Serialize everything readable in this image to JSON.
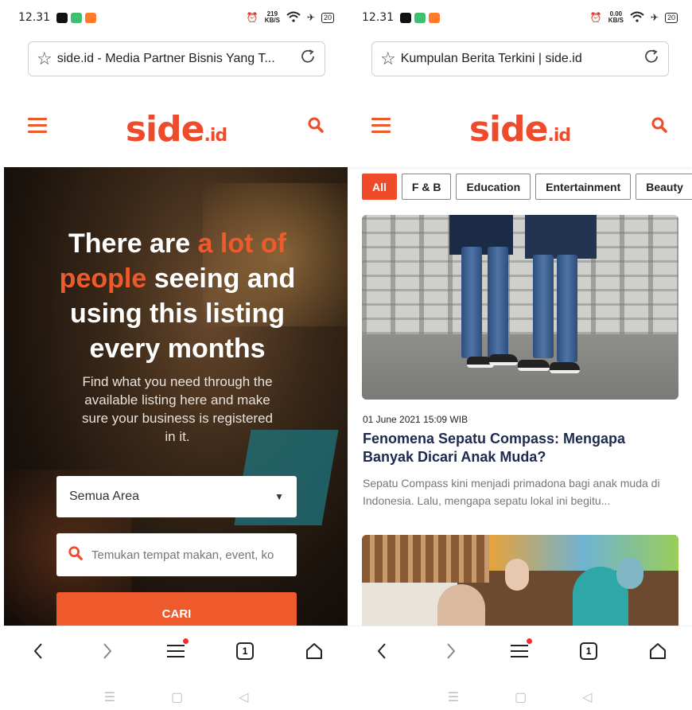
{
  "colors": {
    "accent": "#ef4b2a",
    "headline": "#1d2a50"
  },
  "left": {
    "status": {
      "time": "12.31",
      "speed_value": "219",
      "speed_unit": "KB/S",
      "battery": "20"
    },
    "url_title": "side.id - Media Partner Bisnis Yang T...",
    "logo": {
      "main": "side",
      "suffix": ".id"
    },
    "hero": {
      "title_part1": "There are ",
      "title_highlight": "a lot of people",
      "title_part2": " seeing and using this listing every months",
      "subtitle": "Find what you need through the available listing here and make sure your business is registered in it.",
      "area_select": "Semua Area",
      "search_placeholder": "Temukan tempat makan, event, ko",
      "submit_label": "CARI"
    },
    "tab_count": "1"
  },
  "right": {
    "status": {
      "time": "12.31",
      "speed_value": "0.00",
      "speed_unit": "KB/S",
      "battery": "20"
    },
    "url_title": "Kumpulan Berita Terkini | side.id",
    "logo": {
      "main": "side",
      "suffix": ".id"
    },
    "tags": [
      "All",
      "F & B",
      "Education",
      "Entertainment",
      "Beauty"
    ],
    "article": {
      "date": "01 June 2021 15:09 WIB",
      "title": "Fenomena Sepatu Compass: Mengapa Banyak Dicari Anak Muda?",
      "excerpt": "Sepatu Compass kini menjadi primadona bagi anak muda di Indonesia. Lalu, mengapa sepatu lokal ini begitu..."
    },
    "tab_count": "1"
  }
}
